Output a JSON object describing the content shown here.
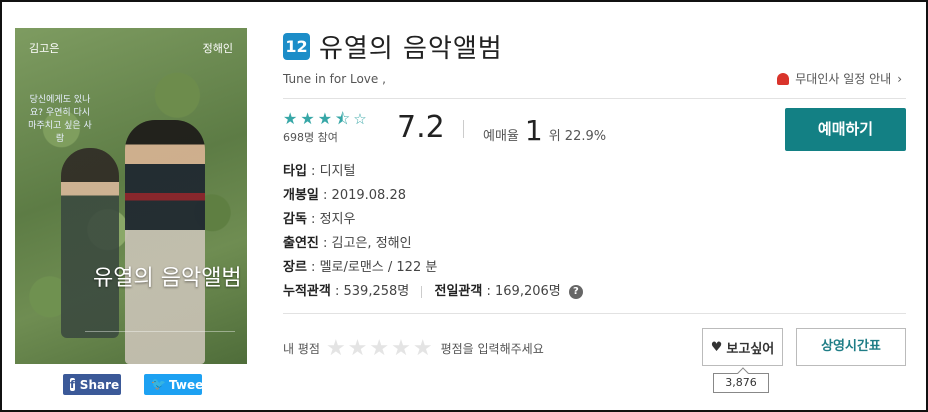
{
  "poster": {
    "actor_left": "김고은",
    "actor_right": "정해인",
    "tagline": "당신에게도 있나요? 우연히 다시 마주치고 싶은 사람",
    "poster_title": "유열의 음악앨범"
  },
  "share": {
    "facebook": "Share",
    "twitter": "Tweet"
  },
  "movie": {
    "age_rating": "12",
    "title": "유열의 음악앨범",
    "english_title": "Tune in for Love ,",
    "notice": "무대인사 일정 안내",
    "stars": 3.5,
    "participants": "698명 참여",
    "score": "7.2",
    "rank_label": "예매율",
    "rank": "1",
    "rank_suffix": "위 22.9%",
    "reserve_button": "예매하기",
    "details": {
      "type_label": "타입",
      "type": "디지털",
      "release_label": "개봉일",
      "release": "2019.08.28",
      "director_label": "감독",
      "director": "정지우",
      "cast_label": "출연진",
      "cast": "김고은, 정해인",
      "genre_label": "장르",
      "genre": "멜로/로맨스 / 122 분",
      "cumulative_label": "누적관객",
      "cumulative": "539,258명",
      "daily_label": "전일관객",
      "daily": "169,206명"
    }
  },
  "my_rating": {
    "label": "내 평점",
    "placeholder": "평점을 입력해주세요"
  },
  "actions": {
    "want_label": "보고싶어",
    "want_count": "3,876",
    "schedule_label": "상영시간표"
  },
  "colors": {
    "accent": "#138084",
    "badge": "#1c8dc8",
    "star": "#37a7a7"
  }
}
